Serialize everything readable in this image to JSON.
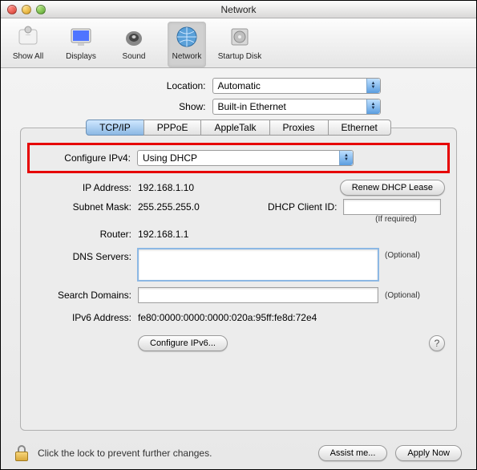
{
  "window": {
    "title": "Network"
  },
  "toolbar": {
    "items": [
      {
        "label": "Show All",
        "name": "show-all"
      },
      {
        "label": "Displays",
        "name": "displays"
      },
      {
        "label": "Sound",
        "name": "sound"
      },
      {
        "label": "Network",
        "name": "network",
        "selected": true
      },
      {
        "label": "Startup Disk",
        "name": "startup-disk"
      }
    ]
  },
  "location": {
    "label": "Location:",
    "value": "Automatic"
  },
  "show": {
    "label": "Show:",
    "value": "Built-in Ethernet"
  },
  "tabs": [
    "TCP/IP",
    "PPPoE",
    "AppleTalk",
    "Proxies",
    "Ethernet"
  ],
  "active_tab": "TCP/IP",
  "tcpip": {
    "configure_label": "Configure IPv4:",
    "configure_value": "Using DHCP",
    "ip_label": "IP Address:",
    "ip_value": "192.168.1.10",
    "renew_button": "Renew DHCP Lease",
    "subnet_label": "Subnet Mask:",
    "subnet_value": "255.255.255.0",
    "dhcp_client_label": "DHCP Client ID:",
    "dhcp_client_value": "",
    "dhcp_client_hint": "(If required)",
    "router_label": "Router:",
    "router_value": "192.168.1.1",
    "dns_label": "DNS Servers:",
    "dns_value": "",
    "dns_hint": "(Optional)",
    "search_label": "Search Domains:",
    "search_value": "",
    "search_hint": "(Optional)",
    "ipv6addr_label": "IPv6 Address:",
    "ipv6addr_value": "fe80:0000:0000:0000:020a:95ff:fe8d:72e4",
    "configure_ipv6_button": "Configure IPv6..."
  },
  "footer": {
    "lock_text": "Click the lock to prevent further changes.",
    "assist_button": "Assist me...",
    "apply_button": "Apply Now"
  }
}
